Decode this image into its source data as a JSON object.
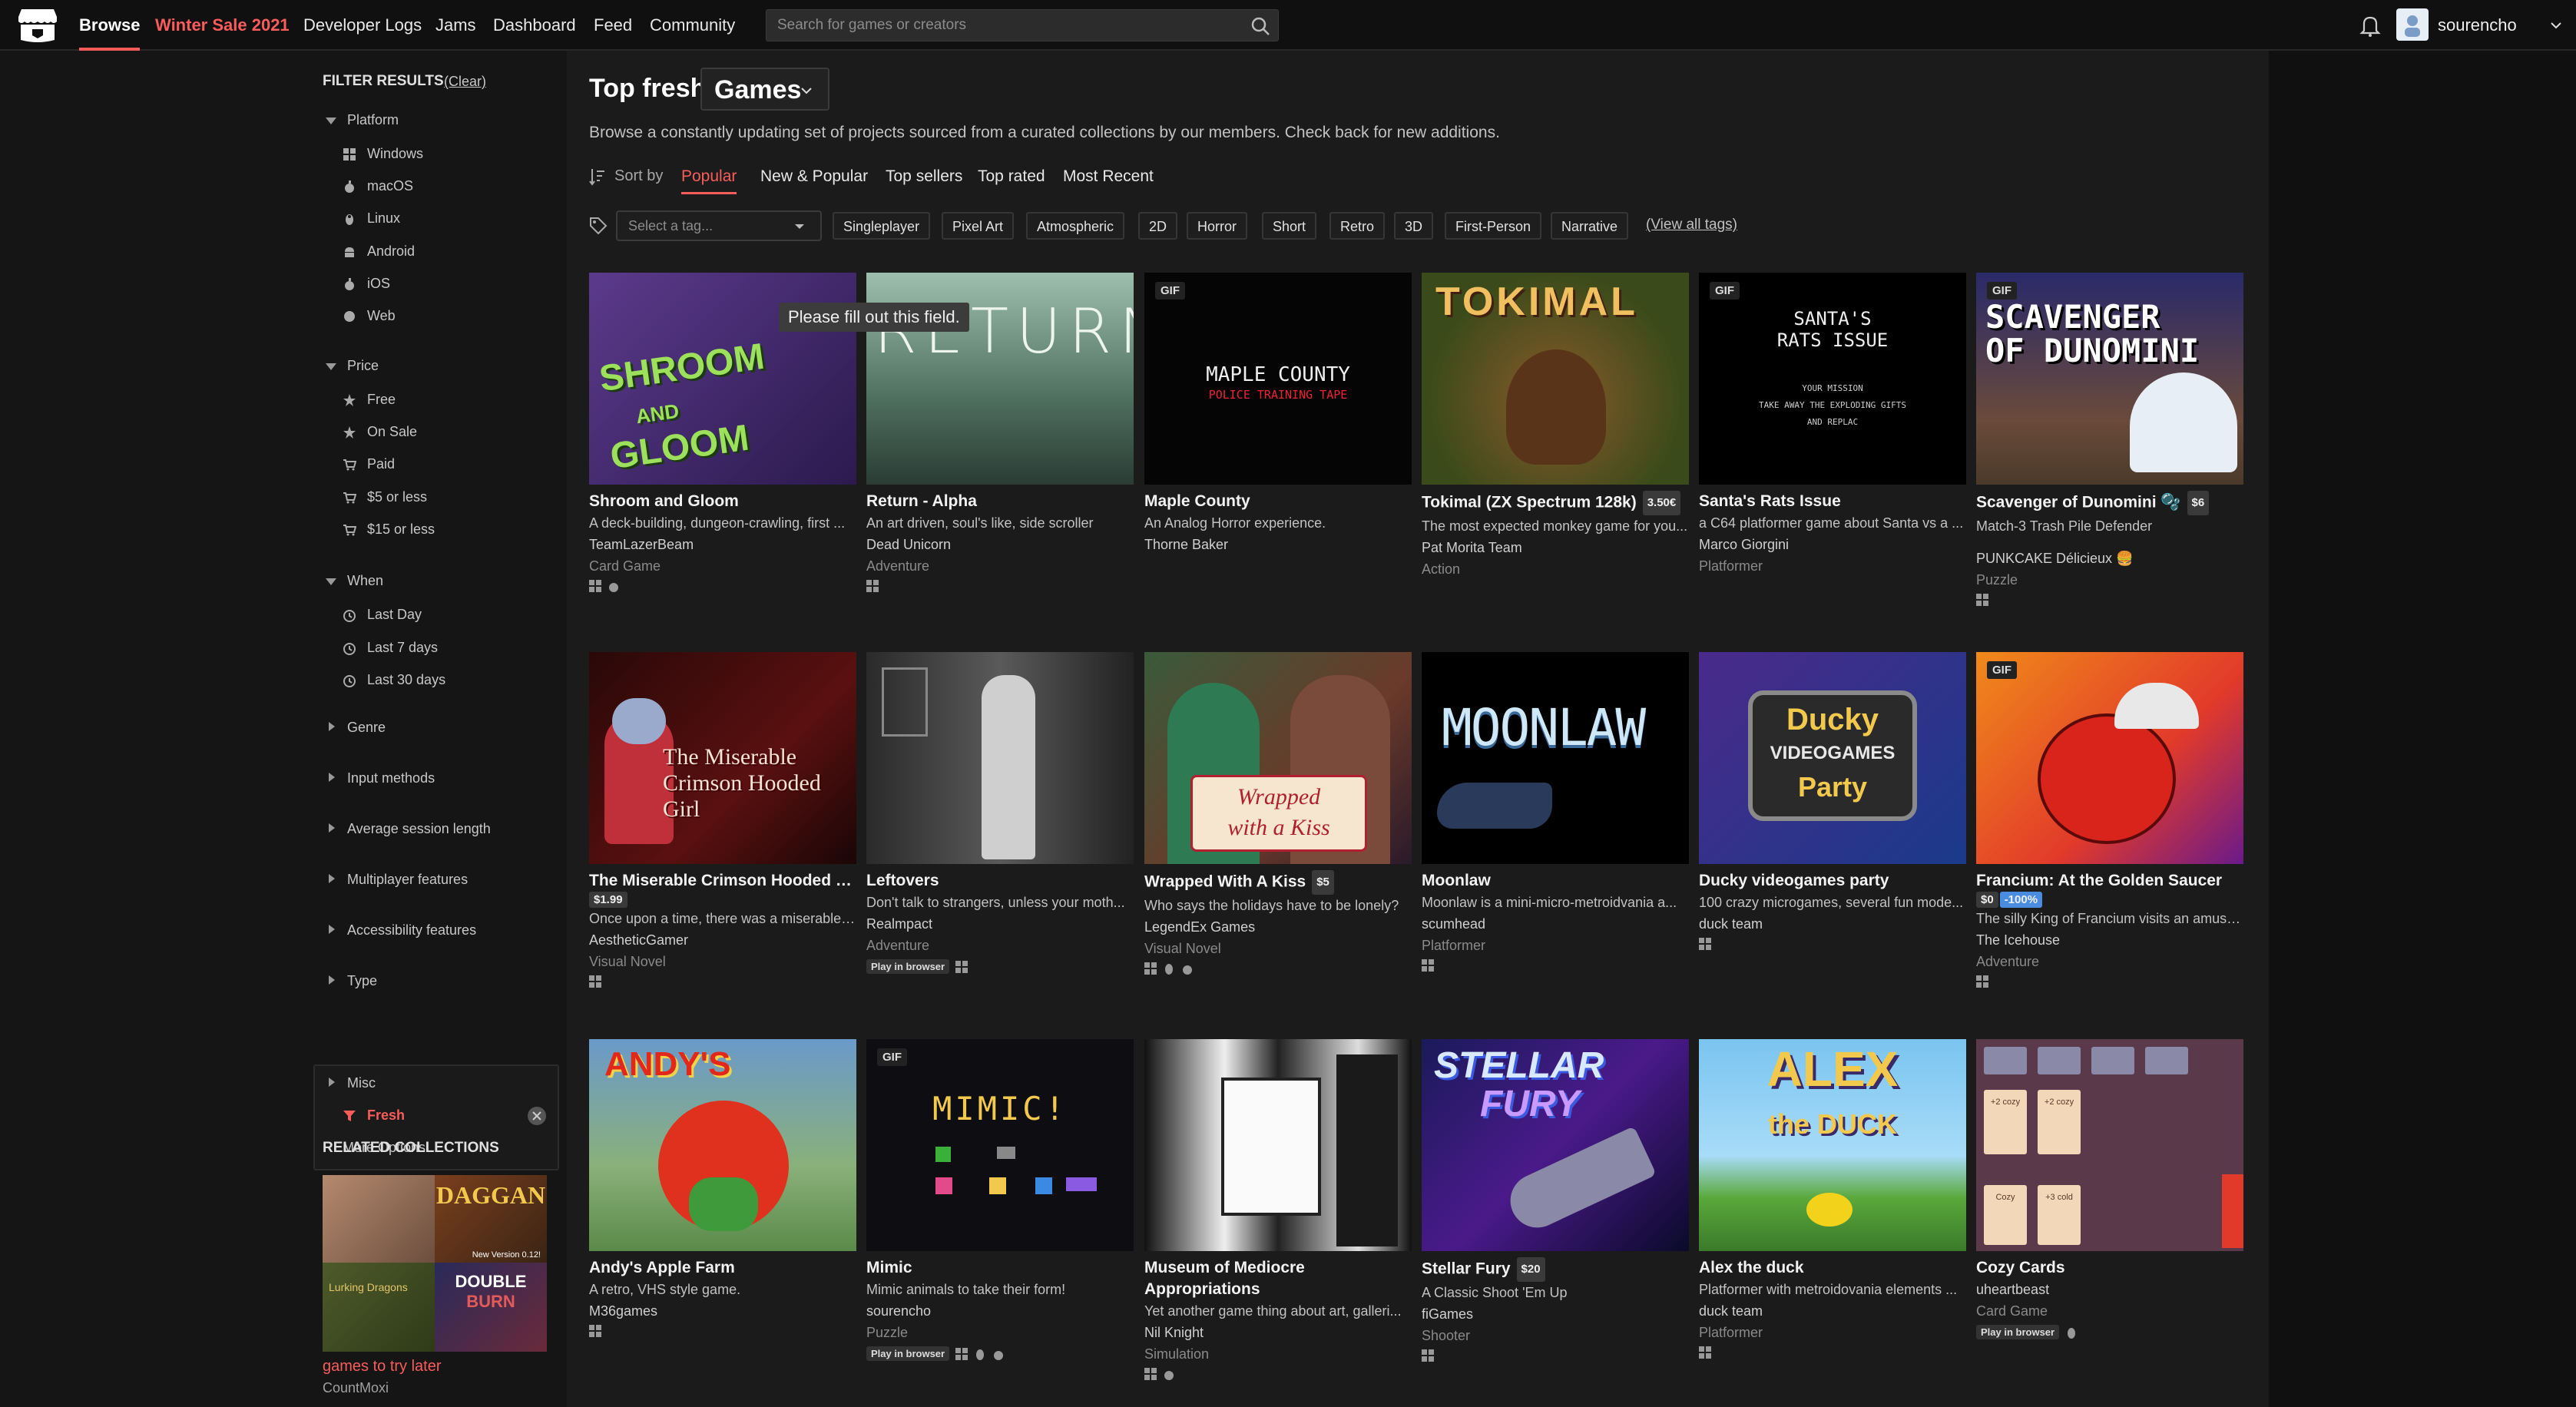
{
  "topbar": {
    "nav": [
      "Browse",
      "Winter Sale 2021",
      "Developer Logs",
      "Jams",
      "Dashboard",
      "Feed",
      "Community"
    ],
    "search_placeholder": "Search for games or creators",
    "username": "sourencho"
  },
  "sidebar": {
    "filter_title": "FILTER RESULTS",
    "clear": "(Clear)",
    "platform": {
      "label": "Platform",
      "items": [
        "Windows",
        "macOS",
        "Linux",
        "Android",
        "iOS",
        "Web"
      ]
    },
    "price": {
      "label": "Price",
      "items": [
        "Free",
        "On Sale",
        "Paid",
        "$5 or less",
        "$15 or less"
      ]
    },
    "when": {
      "label": "When",
      "items": [
        "Last Day",
        "Last 7 days",
        "Last 30 days"
      ]
    },
    "collapsed": [
      "Genre",
      "Input methods",
      "Average session length",
      "Multiplayer features",
      "Accessibility features",
      "Type"
    ],
    "misc": {
      "label": "Misc",
      "active": "Fresh",
      "more": "More Options"
    },
    "related_title": "RELATED COLLECTIONS",
    "collection": {
      "name": "games to try later",
      "author": "CountMoxi"
    }
  },
  "main": {
    "title": "Top fresh",
    "category": "Games",
    "description": "Browse a constantly updating set of projects sourced from a curated collections by our members. Check back for new additions.",
    "sort_label": "Sort by",
    "sorts": [
      "Popular",
      "New & Popular",
      "Top sellers",
      "Top rated",
      "Most Recent"
    ],
    "tag_placeholder": "Select a tag...",
    "tags": [
      "Singleplayer",
      "Pixel Art",
      "Atmospheric",
      "2D",
      "Horror",
      "Short",
      "Retro",
      "3D",
      "First-Person",
      "Narrative"
    ],
    "view_all": "(View all tags)",
    "tooltip": "Please fill out this field."
  },
  "games": [
    {
      "title": "Shroom and Gloom",
      "desc": "A deck-building, dungeon-crawling, first ...",
      "author": "TeamLazerBeam",
      "genre": "Card Game",
      "platforms": [
        "windows",
        "mac"
      ]
    },
    {
      "title": "Return - Alpha",
      "desc": "An art driven, soul's like, side scroller",
      "author": "Dead Unicorn",
      "genre": "Adventure",
      "platforms": [
        "windows"
      ]
    },
    {
      "title": "Maple County",
      "desc": "An Analog Horror experience.",
      "author": "Thorne Baker",
      "genre": "",
      "platforms": [],
      "gif": "GIF"
    },
    {
      "title": "Tokimal (ZX Spectrum 128k)",
      "price": "3.50€",
      "desc": "The most expected monkey game for you...",
      "author": "Pat Morita Team",
      "genre": "Action",
      "platforms": []
    },
    {
      "title": "Santa's Rats Issue",
      "desc": "a C64 platformer game about Santa vs a ...",
      "author": "Marco Giorgini",
      "genre": "Platformer",
      "platforms": [],
      "gif": "GIF"
    },
    {
      "title": "Scavenger of Dunomini 🫧",
      "price": "$6",
      "desc": "Match-3 Trash Pile Defender",
      "author": "PUNKCAKE Délicieux 🍔",
      "genre": "Puzzle",
      "platforms": [
        "windows"
      ],
      "gif": "GIF"
    },
    {
      "title": "The Miserable Crimson Hooded Girl",
      "price": "$1.99",
      "desc": "Once upon a time, there was a miserable ...",
      "author": "AestheticGamer",
      "genre": "Visual Novel",
      "platforms": [
        "windows"
      ]
    },
    {
      "title": "Leftovers",
      "desc": "Don't talk to strangers, unless your moth...",
      "author": "Realmpact",
      "genre": "Adventure",
      "platforms": [
        "browser",
        "windows"
      ],
      "browser": "Play in browser"
    },
    {
      "title": "Wrapped With A Kiss",
      "price": "$5",
      "desc": "Who says the holidays have to be lonely?",
      "author": "LegendEx Games",
      "genre": "Visual Novel",
      "platforms": [
        "windows",
        "linux",
        "mac"
      ]
    },
    {
      "title": "Moonlaw",
      "desc": "Moonlaw is a mini-micro-metroidvania a...",
      "author": "scumhead",
      "genre": "Platformer",
      "platforms": [
        "windows"
      ]
    },
    {
      "title": "Ducky videogames party",
      "desc": "100 crazy microgames, several fun mode...",
      "author": "duck team",
      "genre": "",
      "platforms": [
        "windows"
      ]
    },
    {
      "title": "Francium: At the Golden Saucer",
      "price": "$0",
      "discount": "-100%",
      "desc": "The silly King of Francium visits an amuse...",
      "author": "The Icehouse",
      "genre": "Adventure",
      "platforms": [
        "windows"
      ],
      "gif": "GIF"
    },
    {
      "title": "Andy's Apple Farm",
      "desc": "A retro, VHS style game.",
      "author": "M36games",
      "genre": "",
      "platforms": [
        "windows"
      ]
    },
    {
      "title": "Mimic",
      "desc": "Mimic animals to take their form!",
      "author": "sourencho",
      "genre": "Puzzle",
      "platforms": [
        "browser",
        "windows",
        "linux",
        "mac"
      ],
      "browser": "Play in browser",
      "gif": "GIF"
    },
    {
      "title": "Museum of Mediocre Appropriations",
      "desc": "Yet another game thing about art, galleri...",
      "author": "Nil Knight",
      "genre": "Simulation",
      "platforms": [
        "windows",
        "mac"
      ]
    },
    {
      "title": "Stellar Fury",
      "price": "$20",
      "desc": "A Classic Shoot 'Em Up",
      "author": "fiGames",
      "genre": "Shooter",
      "platforms": [
        "windows"
      ]
    },
    {
      "title": "Alex the duck",
      "desc": "Platformer with metroidovania elements ...",
      "author": "duck team",
      "genre": "Platformer",
      "platforms": [
        "windows"
      ]
    },
    {
      "title": "Cozy Cards",
      "desc": "",
      "author": "uheartbeast",
      "genre": "Card Game",
      "platforms": [
        "browser",
        "linux"
      ],
      "browser": "Play in browser"
    }
  ],
  "thumb_text": {
    "g0": [
      "SHROOM",
      "AND",
      "GLOOM"
    ],
    "g1": "RETURN",
    "g2": [
      "MAPLE COUNTY",
      "POLICE TRAINING TAPE"
    ],
    "g3": "TOKIMAL",
    "g4": [
      "SANTA'S",
      "RATS ISSUE",
      "YOUR MISSION",
      "TAKE AWAY THE EXPLODING GIFTS",
      "AND REPLAC"
    ],
    "g5": [
      "SCAVENGER",
      "OF DUNOMINI"
    ],
    "g6": [
      "The Miserable",
      "Crimson Hooded Girl"
    ],
    "g8": [
      "Wrapped",
      "with a Kiss"
    ],
    "g9": "MOONLAW",
    "g10": [
      "Ducky",
      "VIDEOGAMES",
      "Party"
    ],
    "g12": "ANDY'S",
    "g13": "MIMIC!",
    "g15": [
      "STELLAR",
      "FURY"
    ],
    "g16": [
      "ALEX",
      "the DUCK"
    ],
    "g17": [
      "+2 cozy",
      "+2 cozy",
      "Cozy",
      "+3 cold"
    ],
    "coll": [
      "DAGGAN",
      "New Version 0.12!",
      "DOUBLE",
      "BURN",
      "Lurking Dragons"
    ]
  },
  "colors": {
    "accent": "#fa5c5c",
    "bg": "#1b1b1b",
    "sidebar": "#151515",
    "topbar": "#101010"
  }
}
